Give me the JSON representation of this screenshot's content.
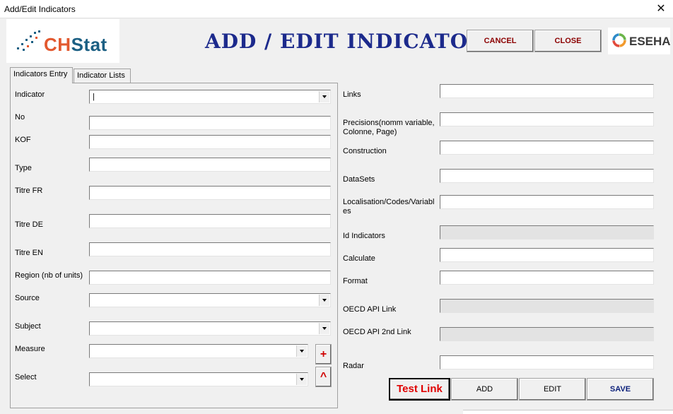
{
  "window": {
    "title": "Add/Edit Indicators",
    "close_glyph": "✕"
  },
  "logo": {
    "ch": "CH",
    "stat": "Stat"
  },
  "heading": "ADD / EDIT INDICATORS",
  "top_buttons": {
    "cancel": "CANCEL",
    "close": "CLOSE"
  },
  "partner_logo": {
    "text": "ESEHA"
  },
  "tabs": [
    {
      "label": "Indicators Entry",
      "active": true
    },
    {
      "label": "Indicator Lists",
      "active": false
    }
  ],
  "left_form": {
    "indicator": {
      "label": "Indicator",
      "value": "|"
    },
    "no": {
      "label": "No",
      "value": ""
    },
    "kof": {
      "label": "KOF",
      "value": ""
    },
    "type": {
      "label": "Type",
      "value": ""
    },
    "titre_fr": {
      "label": "Titre FR",
      "value": ""
    },
    "titre_de": {
      "label": "Titre DE",
      "value": ""
    },
    "titre_en": {
      "label": "Titre EN",
      "value": ""
    },
    "region": {
      "label": "Region (nb of units)",
      "value": ""
    },
    "source": {
      "label": "Source",
      "value": ""
    },
    "subject": {
      "label": "Subject",
      "value": ""
    },
    "measure": {
      "label": "Measure",
      "value": ""
    },
    "select": {
      "label": "Select",
      "value": ""
    },
    "add_measure_glyph": "+",
    "up_glyph": "^"
  },
  "right_form": {
    "links": {
      "label": "Links",
      "value": ""
    },
    "precisions": {
      "label_line1": "Precisions(nomm variable,",
      "label_line2": "Colonne, Page)",
      "value": ""
    },
    "construction": {
      "label": "Construction",
      "value": ""
    },
    "datasets": {
      "label": "DataSets",
      "value": ""
    },
    "localisation": {
      "label_line1": "Localisation/Codes/Variabl",
      "label_line2": "es",
      "value": ""
    },
    "id_indicators": {
      "label": "Id Indicators",
      "value": ""
    },
    "calculate": {
      "label": "Calculate",
      "value": ""
    },
    "format": {
      "label": "Format",
      "value": ""
    },
    "oecd_api_link": {
      "label": "OECD API Link",
      "value": ""
    },
    "oecd_api_2nd_link": {
      "label": "OECD API 2nd Link",
      "value": ""
    },
    "radar": {
      "label": "Radar",
      "value": ""
    }
  },
  "bottom_buttons": {
    "test_link": "Test Link",
    "add": "ADD",
    "edit": "EDIT",
    "save": "SAVE"
  },
  "colors": {
    "heading": "#1c2a8c",
    "logo_ch": "#e2582e",
    "logo_stat": "#1b5f83",
    "button_text": "#8b0000",
    "test_link": "#e00000",
    "save": "#0a1f7a"
  },
  "icons": [
    "close-icon",
    "dropdown-arrow-icon",
    "plus-icon",
    "caret-up-icon"
  ]
}
